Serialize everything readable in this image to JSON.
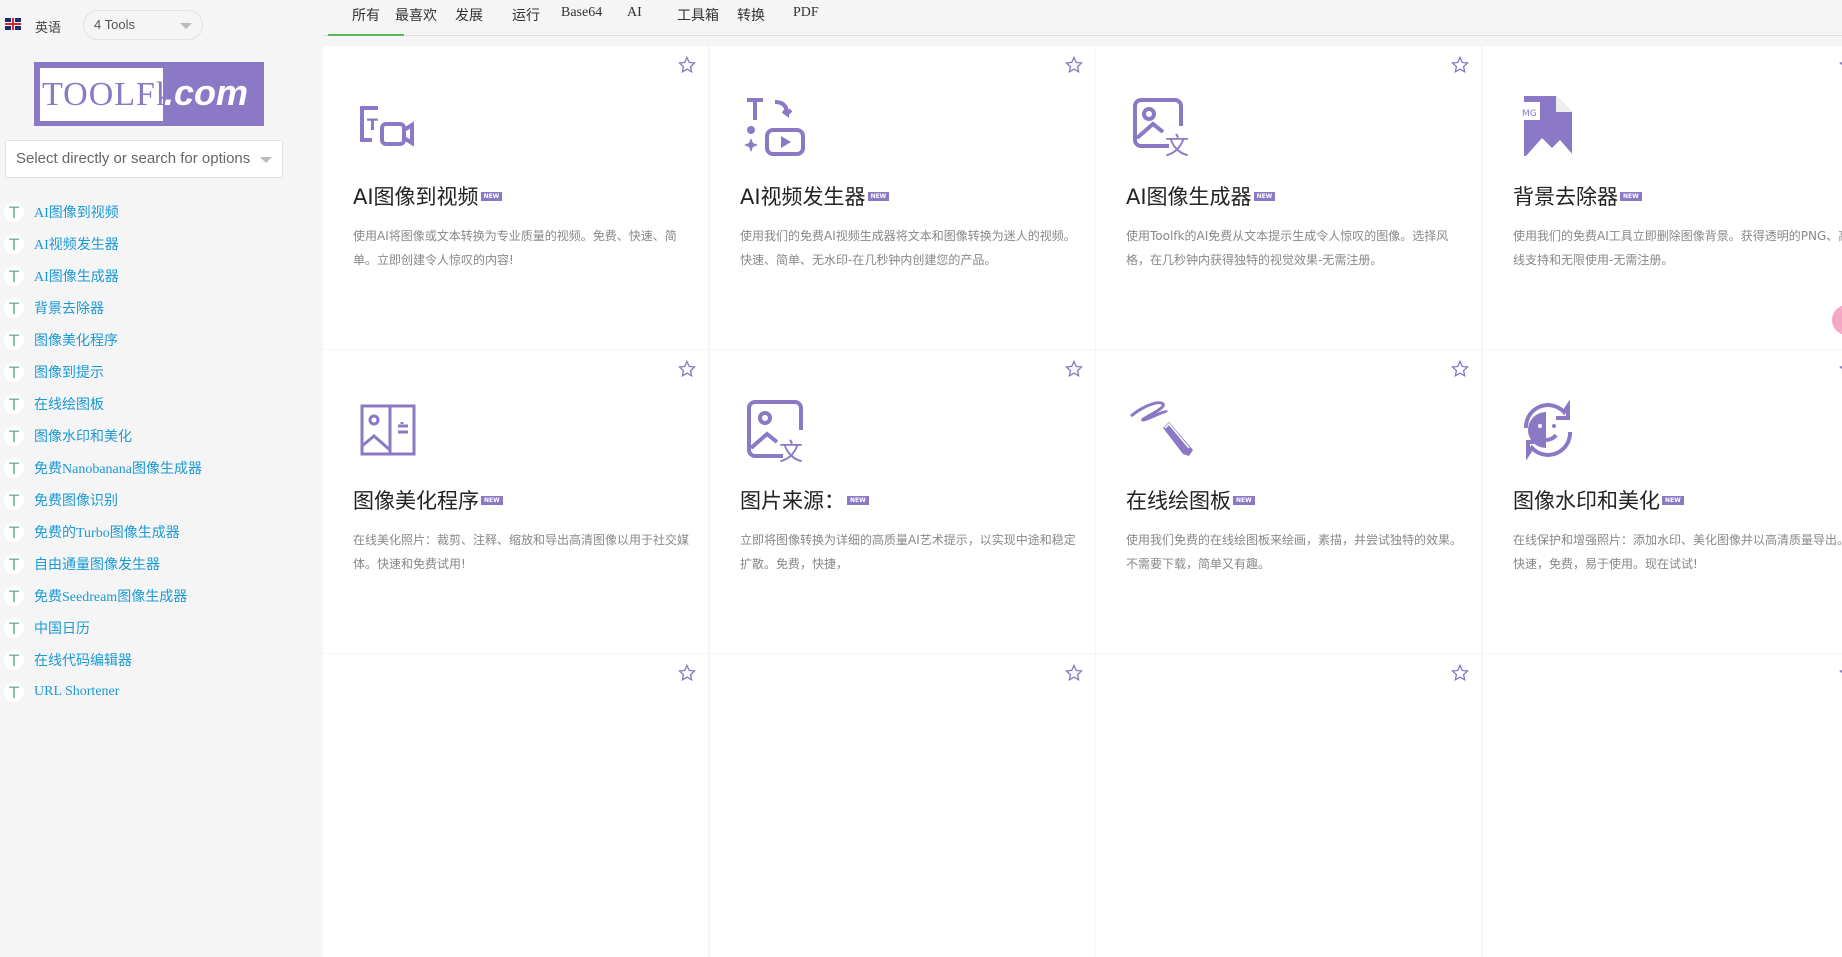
{
  "header": {
    "language": "英语",
    "tools_dropdown": "4 Tools",
    "logo_text": "TOOLFK.com",
    "search_placeholder": "Select directly or search for options"
  },
  "sidebar": {
    "items": [
      "AI图像到视频",
      "AI视频发生器",
      "AI图像生成器",
      "背景去除器",
      "图像美化程序",
      "图像到提示",
      "在线绘图板",
      "图像水印和美化",
      "免费Nanobanana图像生成器",
      "免费图像识别",
      "免费的Turbo图像生成器",
      "自由通量图像发生器",
      "免费Seedream图像生成器",
      "中国日历",
      "在线代码编辑器",
      "URL Shortener"
    ],
    "item_icon": "T"
  },
  "tabs": [
    "所有",
    "最喜欢",
    "发展",
    "运行",
    "Base64",
    "AI",
    "工具箱",
    "转换",
    "PDF"
  ],
  "badge": "NEW",
  "cards": [
    {
      "title": "AI图像到视频",
      "desc": "使用AI将图像或文本转换为专业质量的视频。免费、快速、简单。立即创建令人惊叹的内容!",
      "icon": "text-to-video-icon"
    },
    {
      "title": "AI视频发生器",
      "desc": "使用我们的免费AI视频生成器将文本和图像转换为迷人的视频。快速、简单、无水印-在几秒钟内创建您的产品。",
      "icon": "video-generator-icon"
    },
    {
      "title": "AI图像生成器",
      "desc": "使用Toolfk的AI免费从文本提示生成令人惊叹的图像。选择风格，在几秒钟内获得独特的视觉效果-无需注册。",
      "icon": "image-translate-icon"
    },
    {
      "title": "背景去除器",
      "desc": "使用我们的免费AI工具立即删除图像背景。获得透明的PNG、高线支持和无限使用-无需注册。",
      "icon": "image-file-icon"
    },
    {
      "title": "图像美化程序",
      "desc": "在线美化照片：裁剪、注释、缩放和导出高清图像以用于社交媒体。快速和免费试用!",
      "icon": "image-editor-icon"
    },
    {
      "title": "图片来源：",
      "desc": "立即将图像转换为详细的高质量AI艺术提示，以实现中途和稳定扩散。免费，快捷，",
      "icon": "image-to-prompt-icon"
    },
    {
      "title": "在线绘图板",
      "desc": "使用我们免费的在线绘图板来绘画，素描，并尝试独特的效果。不需要下载，简单又有趣。",
      "icon": "drawing-pen-icon"
    },
    {
      "title": "图像水印和美化",
      "desc": "在线保护和增强照片：添加水印、美化图像并以高清质量导出。快速，免费，易于使用。现在试试!",
      "icon": "face-refresh-icon"
    },
    {
      "title": "",
      "desc": "",
      "icon": ""
    },
    {
      "title": "",
      "desc": "",
      "icon": ""
    },
    {
      "title": "",
      "desc": "",
      "icon": ""
    },
    {
      "title": "",
      "desc": "",
      "icon": ""
    }
  ],
  "colors": {
    "accent": "#8c79c6",
    "link": "#1a9ad6",
    "tab_active": "#5cb85c"
  }
}
